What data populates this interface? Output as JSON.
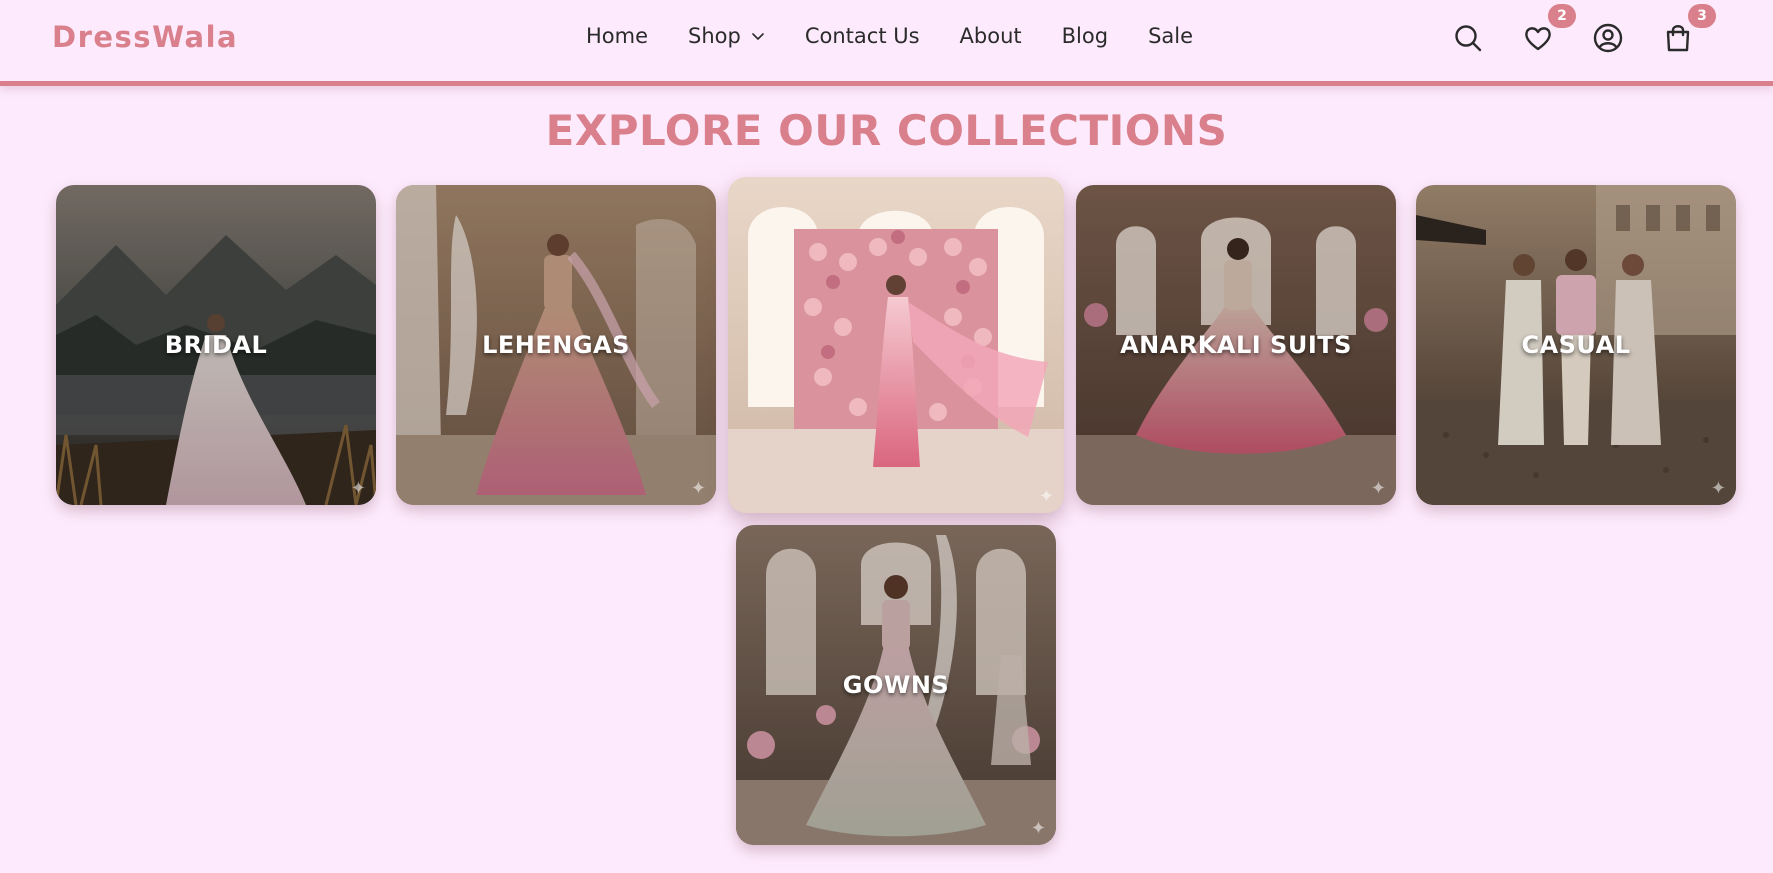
{
  "brand": {
    "logo_text": "DressWala",
    "accent_color": "#d9808c",
    "background_color": "#fdebfd"
  },
  "nav": {
    "items": [
      {
        "label": "Home"
      },
      {
        "label": "Shop",
        "has_dropdown": true
      },
      {
        "label": "Contact Us"
      },
      {
        "label": "About"
      },
      {
        "label": "Blog"
      },
      {
        "label": "Sale"
      }
    ]
  },
  "header_icons": {
    "search": {
      "icon": "search-icon"
    },
    "wishlist": {
      "icon": "heart-icon",
      "count": "2"
    },
    "account": {
      "icon": "user-circle-icon"
    },
    "cart": {
      "icon": "shopping-bag-icon",
      "count": "3"
    }
  },
  "collections": {
    "title": "EXPLORE OUR COLLECTIONS",
    "cards": [
      {
        "label": "BRIDAL"
      },
      {
        "label": "LEHENGAS"
      },
      {
        "label": ""
      },
      {
        "label": "ANARKALI SUITS"
      },
      {
        "label": "CASUAL"
      },
      {
        "label": "GOWNS"
      }
    ],
    "sparkle_glyph": "✦"
  }
}
